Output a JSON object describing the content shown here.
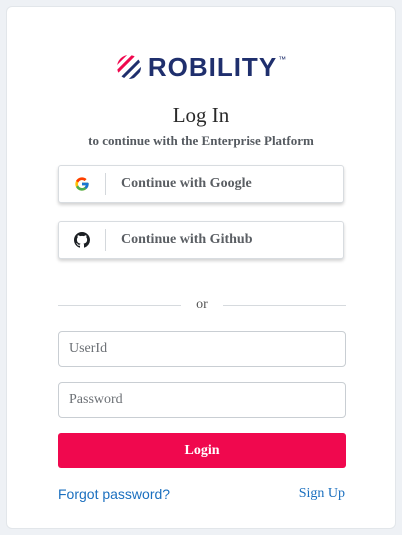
{
  "brand": {
    "name": "ROBILITY",
    "trademark": "™",
    "logo_icon": "robility-logo-icon",
    "colors": {
      "navy": "#1f2f6d",
      "accent": "#f0084e"
    }
  },
  "heading": {
    "title": "Log In",
    "subtitle": "to continue with the Enterprise Platform"
  },
  "social": {
    "google": {
      "label": "Continue with Google",
      "icon": "google-icon"
    },
    "github": {
      "label": "Continue with Github",
      "icon": "github-icon"
    }
  },
  "divider": {
    "text": "or"
  },
  "form": {
    "userid": {
      "placeholder": "UserId",
      "value": ""
    },
    "password": {
      "placeholder": "Password",
      "value": ""
    },
    "login_label": "Login"
  },
  "links": {
    "forgot_password": "Forgot password?",
    "sign_up": "Sign Up"
  }
}
